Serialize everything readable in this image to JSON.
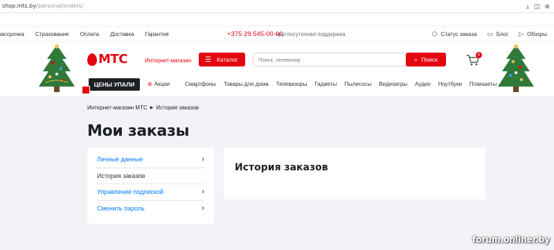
{
  "browser": {
    "url_domain": "shop.mts.by",
    "url_path": "/personal/orders/",
    "icons": [
      "download-icon",
      "screenshot-icon",
      "bookmark-icon"
    ]
  },
  "topmenu": {
    "links": [
      "рассрочка",
      "Страхование",
      "Оплата",
      "Доставка",
      "Гарантия"
    ],
    "phone": "+375 29 545-00-00",
    "support": "круглосуточная поддержка",
    "right": [
      {
        "icon": "box-icon",
        "label": "Статус заказа"
      },
      {
        "icon": "chat-icon",
        "label": "Блог"
      },
      {
        "icon": "play-icon",
        "label": "Обзоры"
      }
    ]
  },
  "header": {
    "brand": "МТС",
    "shop_label": "Интернет-магазин",
    "catalog": "Каталог",
    "search_placeholder": "Поиск, телевизор",
    "search_button": "Поиск",
    "cart_count": "0",
    "promo": "ЦЕНЫ УПАЛИ"
  },
  "catnav": [
    "Акции",
    "Смартфоны",
    "Товары для дома",
    "Телевизоры",
    "Гаджеты",
    "Пылесосы",
    "Видеоигры",
    "Аудио",
    "Ноутбуки",
    "Планшеты"
  ],
  "breadcrumb": {
    "home": "Интернет-магазин МТС",
    "current": "История заказов"
  },
  "page_title": "Мои заказы",
  "sidebar": {
    "items": [
      {
        "label": "Личные данные",
        "link": true
      },
      {
        "label": "История заказов",
        "link": false
      },
      {
        "label": "Управление подпиской",
        "link": true
      },
      {
        "label": "Сменить пароль",
        "link": true
      }
    ]
  },
  "content": {
    "heading": "История заказов"
  },
  "watermark": "forum.onliner.by",
  "colors": {
    "accent": "#e30611",
    "link": "#007cff",
    "background": "#f2f3f7"
  }
}
